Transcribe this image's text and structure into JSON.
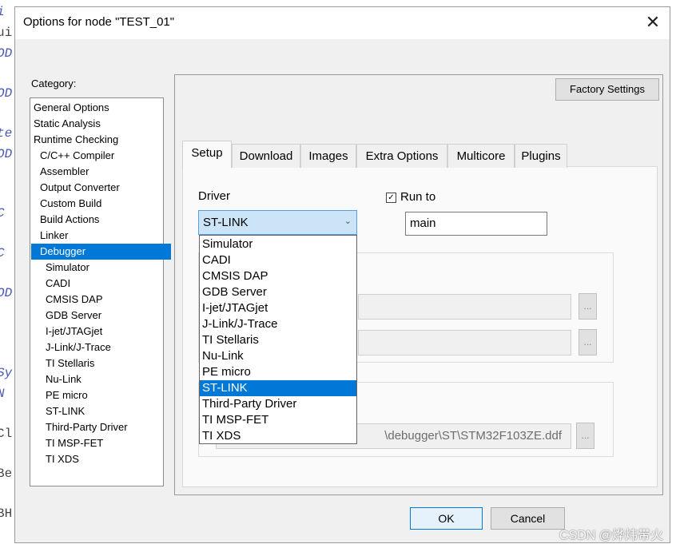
{
  "dialog": {
    "title": "Options for node \"TEST_01\"",
    "close_icon": "close-icon"
  },
  "category": {
    "label": "Category:",
    "items": [
      "General Options",
      "Static Analysis",
      "Runtime Checking",
      "C/C++ Compiler",
      "Assembler",
      "Output Converter",
      "Custom Build",
      "Build Actions",
      "Linker",
      "Debugger",
      "Simulator",
      "CADI",
      "CMSIS DAP",
      "GDB Server",
      "I-jet/JTAGjet",
      "J-Link/J-Trace",
      "TI Stellaris",
      "Nu-Link",
      "PE micro",
      "ST-LINK",
      "Third-Party Driver",
      "TI MSP-FET",
      "TI XDS"
    ],
    "selected": "Debugger"
  },
  "factory_settings_label": "Factory Settings",
  "tabs": [
    "Setup",
    "Download",
    "Images",
    "Extra Options",
    "Multicore",
    "Plugins"
  ],
  "active_tab": "Setup",
  "setup": {
    "driver_label": "Driver",
    "driver_value": "ST-LINK",
    "run_to_label": "Run to",
    "run_to_checked": true,
    "run_to_value": "main",
    "ddf_path_visible": "\\debugger\\ST\\STM32F103ZE.ddf",
    "browse_label": "..."
  },
  "driver_dropdown": {
    "options": [
      "Simulator",
      "CADI",
      "CMSIS DAP",
      "GDB Server",
      "I-jet/JTAGjet",
      "J-Link/J-Trace",
      "TI Stellaris",
      "Nu-Link",
      "PE micro",
      "ST-LINK",
      "Third-Party Driver",
      "TI MSP-FET",
      "TI XDS"
    ],
    "highlighted": "ST-LINK"
  },
  "buttons": {
    "ok": "OK",
    "cancel": "Cancel"
  },
  "watermark": "CSDN @烨炜带火",
  "background_code_fragments": [
    "i",
    "ui",
    "OD",
    "OD",
    "te",
    "OD",
    "C",
    "C",
    "OD",
    "Sy",
    "N",
    "Cl",
    "Be",
    "BH"
  ],
  "colors": {
    "selection": "#0078d7",
    "dialog_bg": "#f0f0f0",
    "combo_bg": "#cce4f7"
  }
}
